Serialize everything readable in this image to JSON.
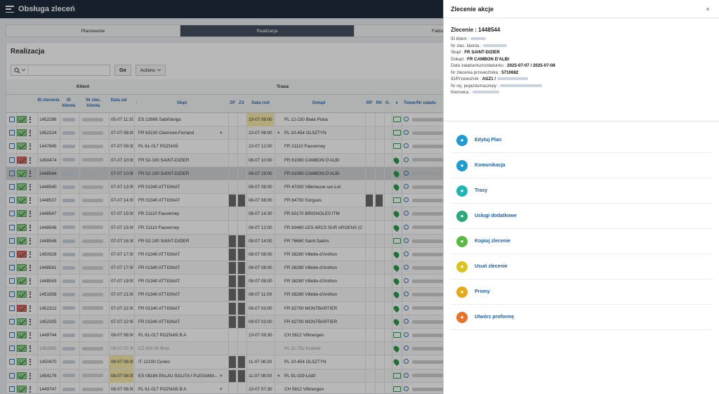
{
  "header": {
    "title": "Obsługa zleceń"
  },
  "tabs": [
    {
      "label": "Planowanie"
    },
    {
      "label": "Realizacja",
      "active": true
    },
    {
      "label": "Faktur"
    }
  ],
  "panel": {
    "title": "Realizacja",
    "go_label": "Go",
    "actions_label": "Actions"
  },
  "grid": {
    "groups": {
      "klient": "Klient",
      "trasa": "Trasa"
    },
    "columns": {
      "id_zlecenia": "ID zlecenia",
      "id_klienta": "ID klienta",
      "nr_zlec_klienta": "Nr zlec. klienta",
      "data_zal": "Data zał",
      "skad": "Skąd",
      "zp": "ZP",
      "zx": "ZX",
      "data_rozl": "Data rozł",
      "dokad": "Dokąd",
      "rp": "RP",
      "rk": "RK",
      "o": "O.",
      "towar": "Towar/Nr załadu"
    },
    "rows": [
      {
        "id": "1452286",
        "data_zal": "05-07 11:30",
        "skad": "ES 22666 Sabiñánigo",
        "data_rozl": "10-07 08:00",
        "dokad": "PL 12-230 Biała Piska",
        "rozl_hl": true,
        "env": "green",
        "icon": "truck"
      },
      {
        "id": "1452224",
        "data_zal": "07-07 08:00",
        "skad": "FR 63100 Clermont-Ferrand",
        "skad_plus": true,
        "data_rozl": "10-07 06:00",
        "dokad": "PL 10-454 OLSZTYN",
        "dokad_plus": true,
        "env": "green",
        "icon": "truck"
      },
      {
        "id": "1447845",
        "data_zal": "07-07 09:30",
        "skad": "PL 61-017 POZNAŃ",
        "data_rozl": "10-07 12:00",
        "dokad": "FR 21110 Fauverney",
        "env": "green",
        "icon": "truck"
      },
      {
        "id": "1450474",
        "data_zal": "07-07 10:00",
        "skad": "FR 52-100 SAINT-DIZIER",
        "data_rozl": "08-07 10:00",
        "dokad": "FR 81990 CAMBON D'ALBI",
        "env": "red",
        "icon": "pin"
      },
      {
        "id": "1448544",
        "data_zal": "07-07 10:00",
        "skad": "FR 52-100 SAINT-DIZIER",
        "data_rozl": "08-07 19:00",
        "dokad": "FR 81990 CAMBON D'ALBI",
        "env": "green",
        "icon": "pin",
        "selected": true
      },
      {
        "id": "1448540",
        "data_zal": "07-07 13:00",
        "skad": "FR 01340 ATTIGNAT",
        "data_rozl": "08-07 08:00",
        "dokad": "FR 47300 Villeneuve-sur-Lot",
        "env": "green",
        "icon": "pin"
      },
      {
        "id": "1448537",
        "data_zal": "07-07 14:00",
        "skad": "FR 01340 ATTIGNAT",
        "zpzx": true,
        "data_rozl": "08-07 08:00",
        "dokad": "FR 84700 Sorgues",
        "rprk": true,
        "env": "green",
        "icon": "truck"
      },
      {
        "id": "1448547",
        "data_zal": "07-07 15:00",
        "skad": "FR 21110 Fauverney",
        "data_rozl": "08-07 14:30",
        "dokad": "FR 83170 BRIGNOLES ITM",
        "env": "green",
        "icon": "pin"
      },
      {
        "id": "1448548",
        "data_zal": "07-07 15:00",
        "skad": "FR 21110 Fauverney",
        "data_rozl": "08-07 12:00",
        "dokad": "FR 83460 LES ARCS SUR ARGENS (C...",
        "env": "green",
        "icon": "pin"
      },
      {
        "id": "1448546",
        "data_zal": "07-07 16:30",
        "skad": "FR 52-100 SAINT-DIZIER",
        "zpzx": true,
        "data_rozl": "08-07 14:00",
        "dokad": "FR 76680 Saint-Saëns",
        "env": "green",
        "icon": "truck"
      },
      {
        "id": "1450928",
        "data_zal": "07-07 17:00",
        "skad": "FR 01340 ATTIGNAT",
        "zpzx": true,
        "data_rozl": "08-07 08:00",
        "dokad": "FR 38280 Villette-d'Anthon",
        "env": "red",
        "icon": "pin"
      },
      {
        "id": "1448541",
        "data_zal": "07-07 17:00",
        "skad": "FR 01340 ATTIGNAT",
        "zpzx": true,
        "data_rozl": "08-07 08:00",
        "dokad": "FR 38280 Villette-d'Anthon",
        "env": "green",
        "icon": "pin"
      },
      {
        "id": "1448543",
        "data_zal": "07-07 19:00",
        "skad": "FR 01340 ATTIGNAT",
        "zpzx": true,
        "data_rozl": "08-07 08:00",
        "dokad": "FR 38280 Villette-d'Anthon",
        "env": "green",
        "icon": "pin"
      },
      {
        "id": "1451658",
        "data_zal": "07-07 21:00",
        "skad": "FR 01340 ATTIGNAT",
        "zpzx": true,
        "data_rozl": "08-07 11:00",
        "dokad": "FR 38280 Villette-d'Anthon",
        "env": "green",
        "icon": "pin"
      },
      {
        "id": "1452312",
        "data_zal": "07-07 22:00",
        "skad": "FR 01340 ATTIGNAT",
        "zpzx": true,
        "data_rozl": "09-07 03:00",
        "dokad": "FR 82700 MONTBARTIER",
        "env": "red",
        "icon": "pin"
      },
      {
        "id": "1452305",
        "data_zal": "07-07 22:00",
        "skad": "FR 01340 ATTIGNAT",
        "zpzx": true,
        "data_rozl": "09-07 03:00",
        "dokad": "FR 82700 MONTBARTIER",
        "env": "green",
        "icon": "pin"
      },
      {
        "id": "1449744",
        "data_zal": "08-07 08:00",
        "skad": "PL 61-017 POZNAŃ B A",
        "data_rozl": "10-07 09:30",
        "dokad": "CH 5612 Villmergen",
        "env": "green",
        "icon": "truck"
      },
      {
        "id": "1451665",
        "data_zal": "08-07 07:30",
        "skad": "CZ 643 00 Brno",
        "data_rozl": "",
        "dokad": "PL 31-752 Kraków",
        "env": "green",
        "icon": "pin",
        "grey": true
      },
      {
        "id": "1450470",
        "data_zal": "08-07 08:00",
        "zal_hl": true,
        "skad": "IT 12100 Cuneo",
        "zpzx": true,
        "data_rozl": "11-07 06:30",
        "dokad": "PL 10-454 OLSZTYN",
        "env": "green",
        "icon": "pin"
      },
      {
        "id": "1454176",
        "data_zal": "08-07 08:00",
        "zal_hl": true,
        "skad": "ES 08184 PALAU SOLITA I PLEGAMA...",
        "skad_plus": true,
        "zpzx": true,
        "data_rozl": "11-07 08:00",
        "dokad": "PL 91-029 Łódź",
        "dokad_plus": true,
        "env": "green",
        "icon": "truck"
      },
      {
        "id": "1449747",
        "data_zal": "08-07 08:00",
        "skad": "PL 61-017 POZNAŃ B A",
        "skad_plus": true,
        "data_rozl": "10-07 07:30",
        "dokad": "CH 5612 Villmergen",
        "env": "green",
        "icon": "truck"
      }
    ]
  },
  "drawer": {
    "title": "Zlecenie akcje",
    "close_label": "×",
    "order_label": "Zlecenie :",
    "order_no": "1448544",
    "id_klient_label": "ID klient :",
    "nr_zlec_klienta_label": "Nr zlec. klienta :",
    "skad_label": "Skąd :",
    "skad_value": "FR SAINT-DIZIER",
    "dokad_label": "Dokąd :",
    "dokad_value": "FR CAMBON D'ALBI",
    "data_label": "Data załadunku/rozładunku :",
    "data_value": "2025-07-07 / 2025-07-08",
    "nr_przewoznika_label": "Nr zlecenia przewoźnika :",
    "nr_przewoznika_value": "5710682",
    "przewoznik_label": "ID/Przewoźnik :",
    "przewoznik_value": "ASZ1 /",
    "nr_rej_label": "Nr rej. pojazdu/naczepy :",
    "kierowca_label": "Kierowca :",
    "actions": [
      {
        "label": "Edytuj Plan",
        "color": "#1f9bd1",
        "icon": "edit-plan-icon"
      },
      {
        "label": "Komunikacja",
        "color": "#1f9bd1",
        "icon": "mail-icon"
      },
      {
        "label": "Trasy",
        "color": "#1fb5b5",
        "icon": "route-icon"
      },
      {
        "label": "Usługi dodatkowe",
        "color": "#2ca87a",
        "icon": "services-icon"
      },
      {
        "label": "Kopiuj zlecenie",
        "color": "#59b944",
        "icon": "copy-icon"
      },
      {
        "label": "Usuń zlecenie",
        "color": "#d9c521",
        "icon": "trash-icon"
      },
      {
        "label": "Promy",
        "color": "#e8a917",
        "icon": "lock-icon"
      },
      {
        "label": "Utwórz proformę",
        "color": "#e8722a",
        "icon": "invoice-icon"
      }
    ]
  }
}
